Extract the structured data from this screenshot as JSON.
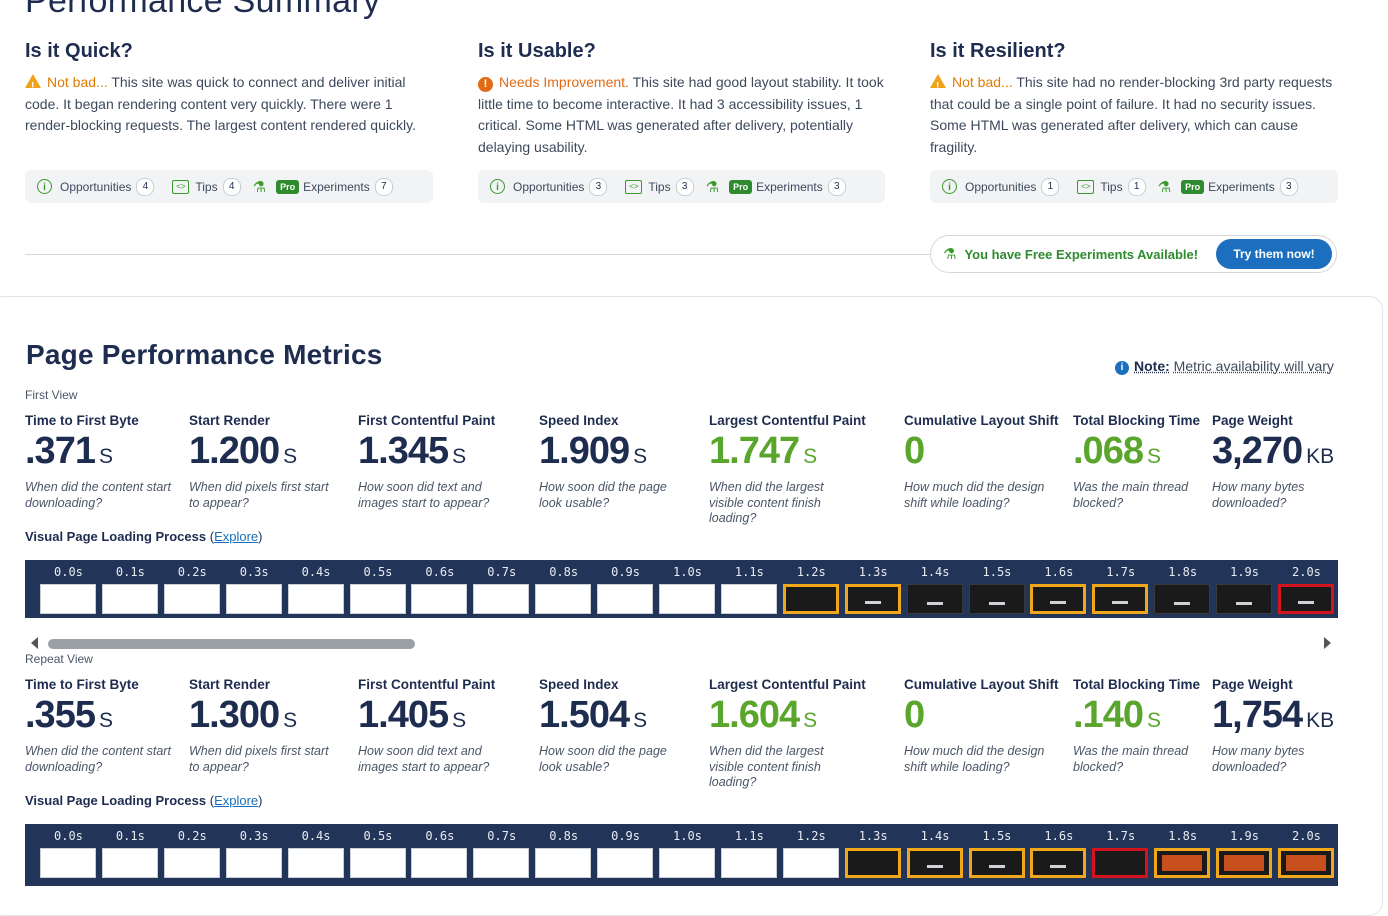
{
  "summary": {
    "title": "Performance Summary",
    "columns": [
      {
        "heading": "Is it Quick?",
        "status_icon": "warning-icon",
        "status": "Not bad...",
        "text": " This site was quick to connect and deliver initial code. It began rendering content very quickly. There were 1 render-blocking requests. The largest content rendered quickly.",
        "opportunities_label": "Opportunities",
        "opportunities_count": "4",
        "tips_label": "Tips",
        "tips_count": "4",
        "pro_label": "Pro",
        "experiments_label": "Experiments",
        "experiments_count": "7"
      },
      {
        "heading": "Is it Usable?",
        "status_icon": "error-icon",
        "status": "Needs Improvement.",
        "text": " This site had good layout stability. It took little time to become interactive. It had 3 accessibility issues, 1 critical. Some HTML was generated after delivery, potentially delaying usability.",
        "opportunities_label": "Opportunities",
        "opportunities_count": "3",
        "tips_label": "Tips",
        "tips_count": "3",
        "pro_label": "Pro",
        "experiments_label": "Experiments",
        "experiments_count": "3"
      },
      {
        "heading": "Is it Resilient?",
        "status_icon": "warning-icon",
        "status": "Not bad...",
        "text": " This site had no render-blocking 3rd party requests that could be a single point of failure. It had no security issues. Some HTML was generated after delivery, which can cause fragility.",
        "opportunities_label": "Opportunities",
        "opportunities_count": "1",
        "tips_label": "Tips",
        "tips_count": "1",
        "pro_label": "Pro",
        "experiments_label": "Experiments",
        "experiments_count": "3"
      }
    ],
    "free_experiments": "You have Free Experiments Available!",
    "try_button": "Try them now!"
  },
  "metrics": {
    "title": "Page Performance Metrics",
    "note_label": "Note:",
    "note_text": "Metric availability will vary",
    "views": [
      {
        "label": "First View",
        "items": [
          {
            "label": "Time to First Byte",
            "value": ".371",
            "unit": "S",
            "green": false,
            "desc": "When did the content start downloading?"
          },
          {
            "label": "Start Render",
            "value": "1.200",
            "unit": "S",
            "green": false,
            "desc": "When did pixels first start to appear?"
          },
          {
            "label": "First Contentful Paint",
            "value": "1.345",
            "unit": "S",
            "green": false,
            "desc": "How soon did text and images start to appear?"
          },
          {
            "label": "Speed Index",
            "value": "1.909",
            "unit": "S",
            "green": false,
            "desc": "How soon did the page look usable?"
          },
          {
            "label": "Largest Contentful Paint",
            "value": "1.747",
            "unit": "S",
            "green": true,
            "desc": "When did the largest visible content finish loading?"
          },
          {
            "label": "Cumulative Layout Shift",
            "value": "0",
            "unit": "",
            "green": true,
            "desc": "How much did the design shift while loading?"
          },
          {
            "label": "Total Blocking Time",
            "value": ".068",
            "unit": "S",
            "green": true,
            "desc": "Was the main thread blocked?"
          },
          {
            "label": "Page Weight",
            "value": "3,270",
            "unit": "KB",
            "green": false,
            "desc": "How many bytes downloaded?"
          }
        ],
        "vpl_label": "Visual Page Loading Process",
        "explore": "Explore",
        "frames": [
          {
            "time": "0.0s",
            "kind": "white"
          },
          {
            "time": "0.1s",
            "kind": "white"
          },
          {
            "time": "0.2s",
            "kind": "white"
          },
          {
            "time": "0.3s",
            "kind": "white"
          },
          {
            "time": "0.4s",
            "kind": "white"
          },
          {
            "time": "0.5s",
            "kind": "white"
          },
          {
            "time": "0.6s",
            "kind": "white"
          },
          {
            "time": "0.7s",
            "kind": "white"
          },
          {
            "time": "0.8s",
            "kind": "white"
          },
          {
            "time": "0.9s",
            "kind": "white"
          },
          {
            "time": "1.0s",
            "kind": "white"
          },
          {
            "time": "1.1s",
            "kind": "white"
          },
          {
            "time": "1.2s",
            "kind": "dark-yellow"
          },
          {
            "time": "1.3s",
            "kind": "dark-yellow-blip"
          },
          {
            "time": "1.4s",
            "kind": "dark-blip"
          },
          {
            "time": "1.5s",
            "kind": "dark-blip"
          },
          {
            "time": "1.6s",
            "kind": "dark-yellow-blip"
          },
          {
            "time": "1.7s",
            "kind": "dark-yellow-blip"
          },
          {
            "time": "1.8s",
            "kind": "dark-blip"
          },
          {
            "time": "1.9s",
            "kind": "dark-blip"
          },
          {
            "time": "2.0s",
            "kind": "dark-red-blip"
          }
        ]
      },
      {
        "label": "Repeat View",
        "items": [
          {
            "label": "Time to First Byte",
            "value": ".355",
            "unit": "S",
            "green": false,
            "desc": "When did the content start downloading?"
          },
          {
            "label": "Start Render",
            "value": "1.300",
            "unit": "S",
            "green": false,
            "desc": "When did pixels first start to appear?"
          },
          {
            "label": "First Contentful Paint",
            "value": "1.405",
            "unit": "S",
            "green": false,
            "desc": "How soon did text and images start to appear?"
          },
          {
            "label": "Speed Index",
            "value": "1.504",
            "unit": "S",
            "green": false,
            "desc": "How soon did the page look usable?"
          },
          {
            "label": "Largest Contentful Paint",
            "value": "1.604",
            "unit": "S",
            "green": true,
            "desc": "When did the largest visible content finish loading?"
          },
          {
            "label": "Cumulative Layout Shift",
            "value": "0",
            "unit": "",
            "green": true,
            "desc": "How much did the design shift while loading?"
          },
          {
            "label": "Total Blocking Time",
            "value": ".140",
            "unit": "S",
            "green": true,
            "desc": "Was the main thread blocked?"
          },
          {
            "label": "Page Weight",
            "value": "1,754",
            "unit": "KB",
            "green": false,
            "desc": "How many bytes downloaded?"
          }
        ],
        "vpl_label": "Visual Page Loading Process",
        "explore": "Explore",
        "frames": [
          {
            "time": "0.0s",
            "kind": "white"
          },
          {
            "time": "0.1s",
            "kind": "white"
          },
          {
            "time": "0.2s",
            "kind": "white"
          },
          {
            "time": "0.3s",
            "kind": "white"
          },
          {
            "time": "0.4s",
            "kind": "white"
          },
          {
            "time": "0.5s",
            "kind": "white"
          },
          {
            "time": "0.6s",
            "kind": "white"
          },
          {
            "time": "0.7s",
            "kind": "white"
          },
          {
            "time": "0.8s",
            "kind": "white"
          },
          {
            "time": "0.9s",
            "kind": "white"
          },
          {
            "time": "1.0s",
            "kind": "white"
          },
          {
            "time": "1.1s",
            "kind": "white"
          },
          {
            "time": "1.2s",
            "kind": "white"
          },
          {
            "time": "1.3s",
            "kind": "dark-yellow"
          },
          {
            "time": "1.4s",
            "kind": "dark-yellow-blip"
          },
          {
            "time": "1.5s",
            "kind": "dark-yellow-blip"
          },
          {
            "time": "1.6s",
            "kind": "dark-yellow-blip"
          },
          {
            "time": "1.7s",
            "kind": "dark-red"
          },
          {
            "time": "1.8s",
            "kind": "orange"
          },
          {
            "time": "1.9s",
            "kind": "orange"
          },
          {
            "time": "2.0s",
            "kind": "orange"
          }
        ]
      }
    ]
  },
  "colors": {
    "navy": "#1e2d4f",
    "green": "#5aa52c",
    "link_blue": "#1b6fbe",
    "warning_orange": "#e07b00",
    "strip_bg": "#223458",
    "frame_highlight": "#f0a81a",
    "frame_lcp": "#d3141e"
  }
}
